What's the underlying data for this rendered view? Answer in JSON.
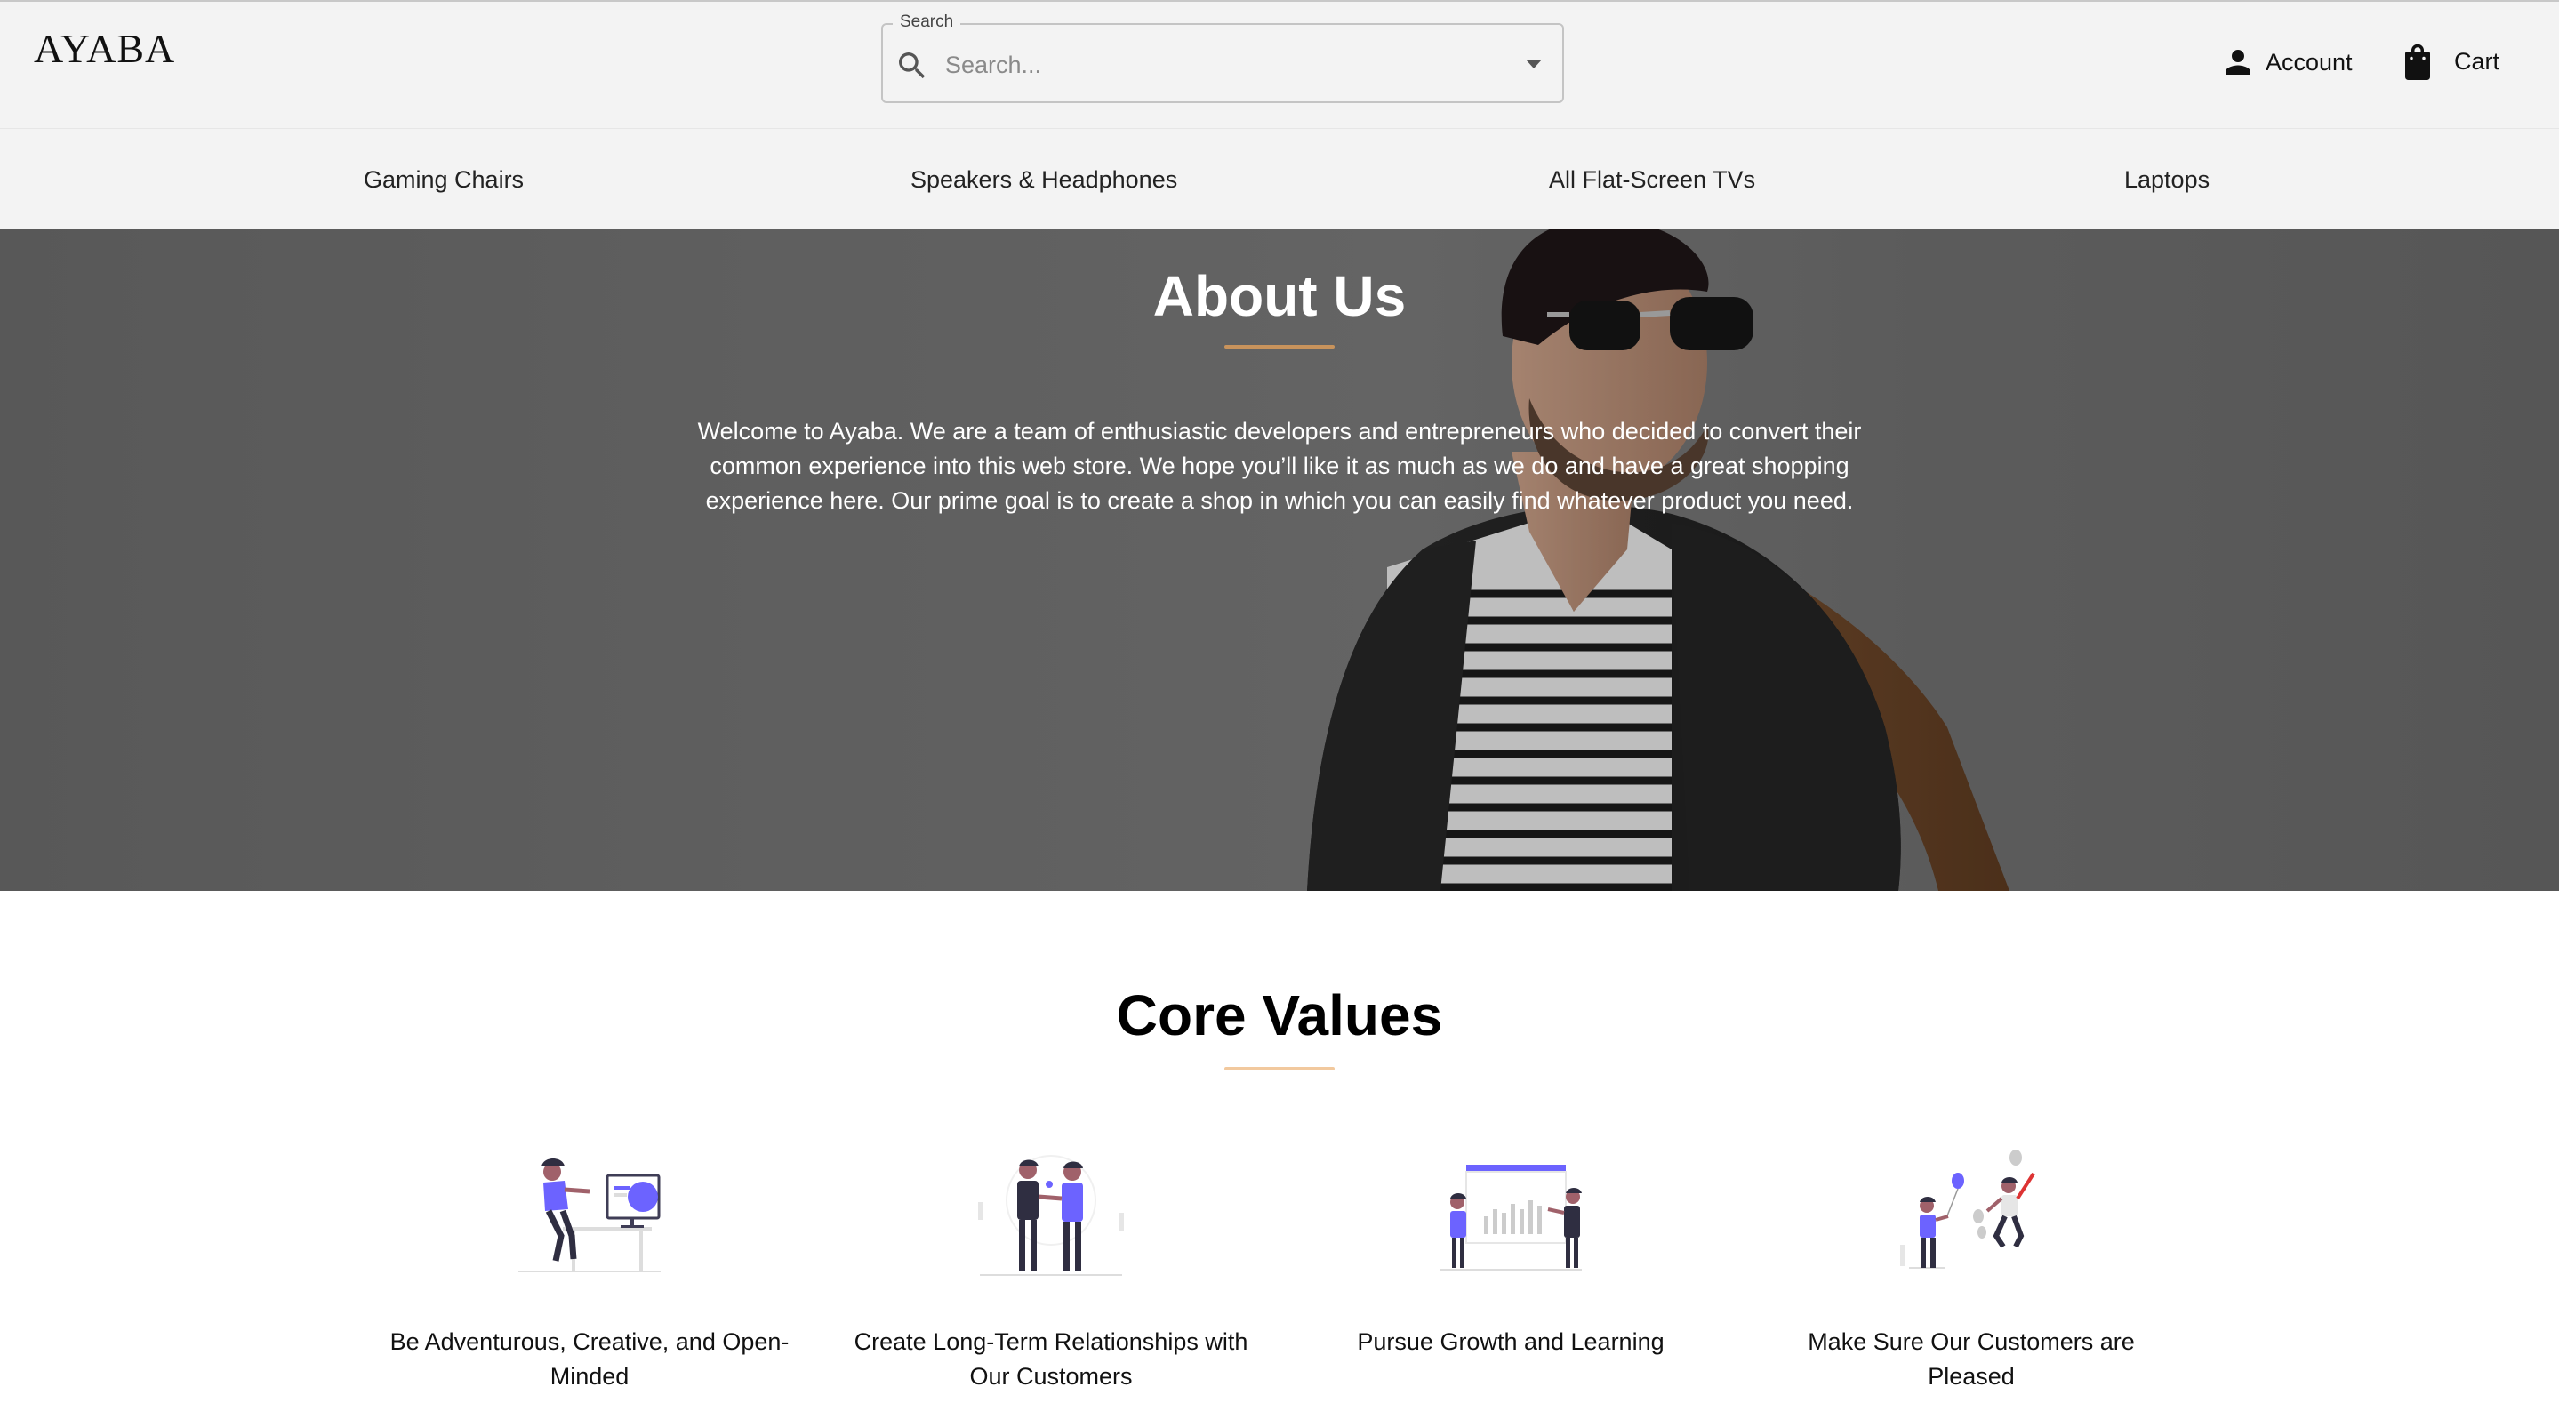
{
  "header": {
    "logo": "AYABA",
    "search": {
      "legend": "Search",
      "placeholder": "Search..."
    },
    "account_label": "Account",
    "cart_label": "Cart"
  },
  "categories": [
    "Gaming Chairs",
    "Speakers & Headphones",
    "All Flat-Screen TVs",
    "Laptops"
  ],
  "hero": {
    "title": "About Us",
    "text": "Welcome to Ayaba. We are a team of enthusiastic developers and entrepreneurs who decided to convert their common experience into this web store. We hope you’ll like it as much as we do and have a great shopping experience here. Our prime goal is to create a shop in which you can easily find whatever product you need."
  },
  "core_values": {
    "title": "Core Values",
    "items": [
      {
        "label": "Be Adventurous, Creative, and Open-Minded",
        "icon": "developer-at-desk-illustration"
      },
      {
        "label": "Create Long-Term Relationships with Our Customers",
        "icon": "handshake-illustration"
      },
      {
        "label": "Pursue Growth and Learning",
        "icon": "presentation-chart-illustration"
      },
      {
        "label": "Make Sure Our Customers are Pleased",
        "icon": "celebration-illustration"
      }
    ]
  },
  "colors": {
    "accent_underline": "#c8935c",
    "illustration_purple": "#6c63ff",
    "header_bg": "#f3f3f3"
  }
}
